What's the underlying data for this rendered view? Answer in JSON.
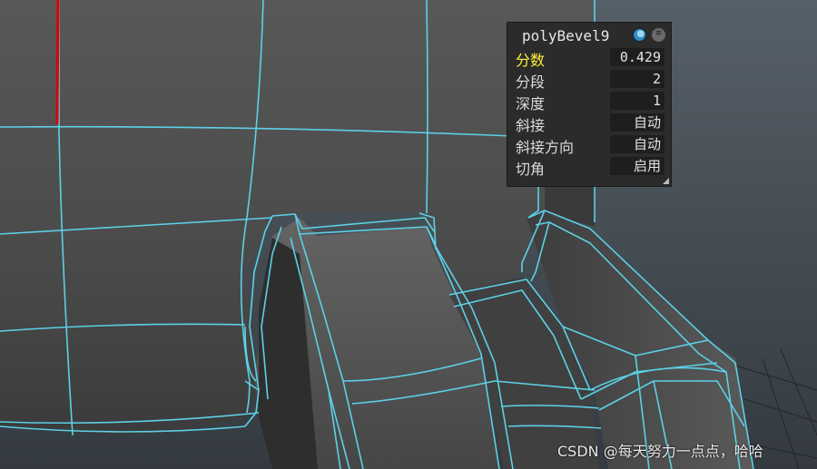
{
  "hud": {
    "title": "polyBevel9",
    "rows": [
      {
        "label": "分数",
        "value": "0.429",
        "active": true
      },
      {
        "label": "分段",
        "value": "2",
        "active": false
      },
      {
        "label": "深度",
        "value": "1",
        "active": false
      },
      {
        "label": "斜接",
        "value": "自动",
        "active": false
      },
      {
        "label": "斜接方向",
        "value": "自动",
        "active": false
      },
      {
        "label": "切角",
        "value": "启用",
        "active": false
      }
    ],
    "icons": [
      "globe-icon",
      "menu-icon",
      "resize-grip-icon"
    ]
  },
  "viewport": {
    "wire_color": "#5bd1e6",
    "axis_color": "#e00000",
    "background_color": "#3f454b"
  },
  "watermark": "CSDN @每天努力一点点，哈哈"
}
